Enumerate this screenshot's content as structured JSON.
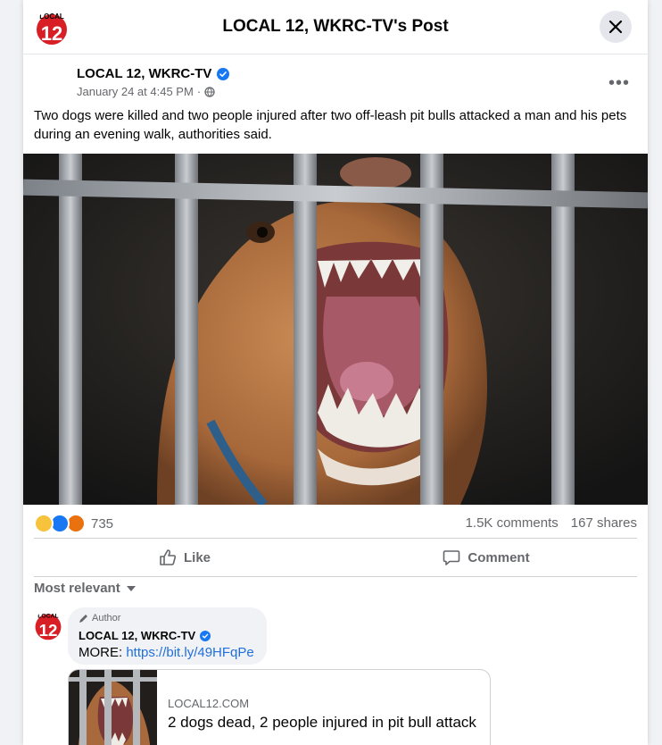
{
  "dialog": {
    "title": "LOCAL 12, WKRC-TV's Post",
    "close_icon": "x-icon"
  },
  "post": {
    "page_name": "LOCAL 12, WKRC-TV",
    "verified_icon": "verified-badge-icon",
    "timestamp": "January 24 at 4:45 PM",
    "separator": "·",
    "audience_icon": "globe-icon",
    "more_icon": "more-horizontal-icon",
    "more_label": "•••",
    "text": "Two dogs were killed and two people injured after two off-leash pit bulls attacked a man and his pets during an evening walk, authorities said.",
    "image_icon": "snarling-dog-photo",
    "logo_text": "LOCAL",
    "logo_number": "12"
  },
  "stats": {
    "reactions": [
      "sad",
      "like",
      "angry"
    ],
    "reaction_count": "735",
    "comments": "1.5K comments",
    "shares": "167 shares"
  },
  "actions": {
    "like_label": "Like",
    "comment_label": "Comment"
  },
  "comments_section": {
    "sort_label": "Most relevant",
    "comment": {
      "author_tag": "Author",
      "name": "LOCAL 12, WKRC-TV",
      "text_prefix": "MORE: ",
      "link": "https://bit.ly/49HFqPe"
    },
    "link_preview": {
      "domain": "LOCAL12.COM",
      "title": "2 dogs dead, 2 people injured in pit bull attack"
    }
  },
  "colors": {
    "link_blue": "#216fdb",
    "verified_blue": "#1877f2",
    "logo_red": "#d81f26",
    "muted": "#65676b"
  }
}
